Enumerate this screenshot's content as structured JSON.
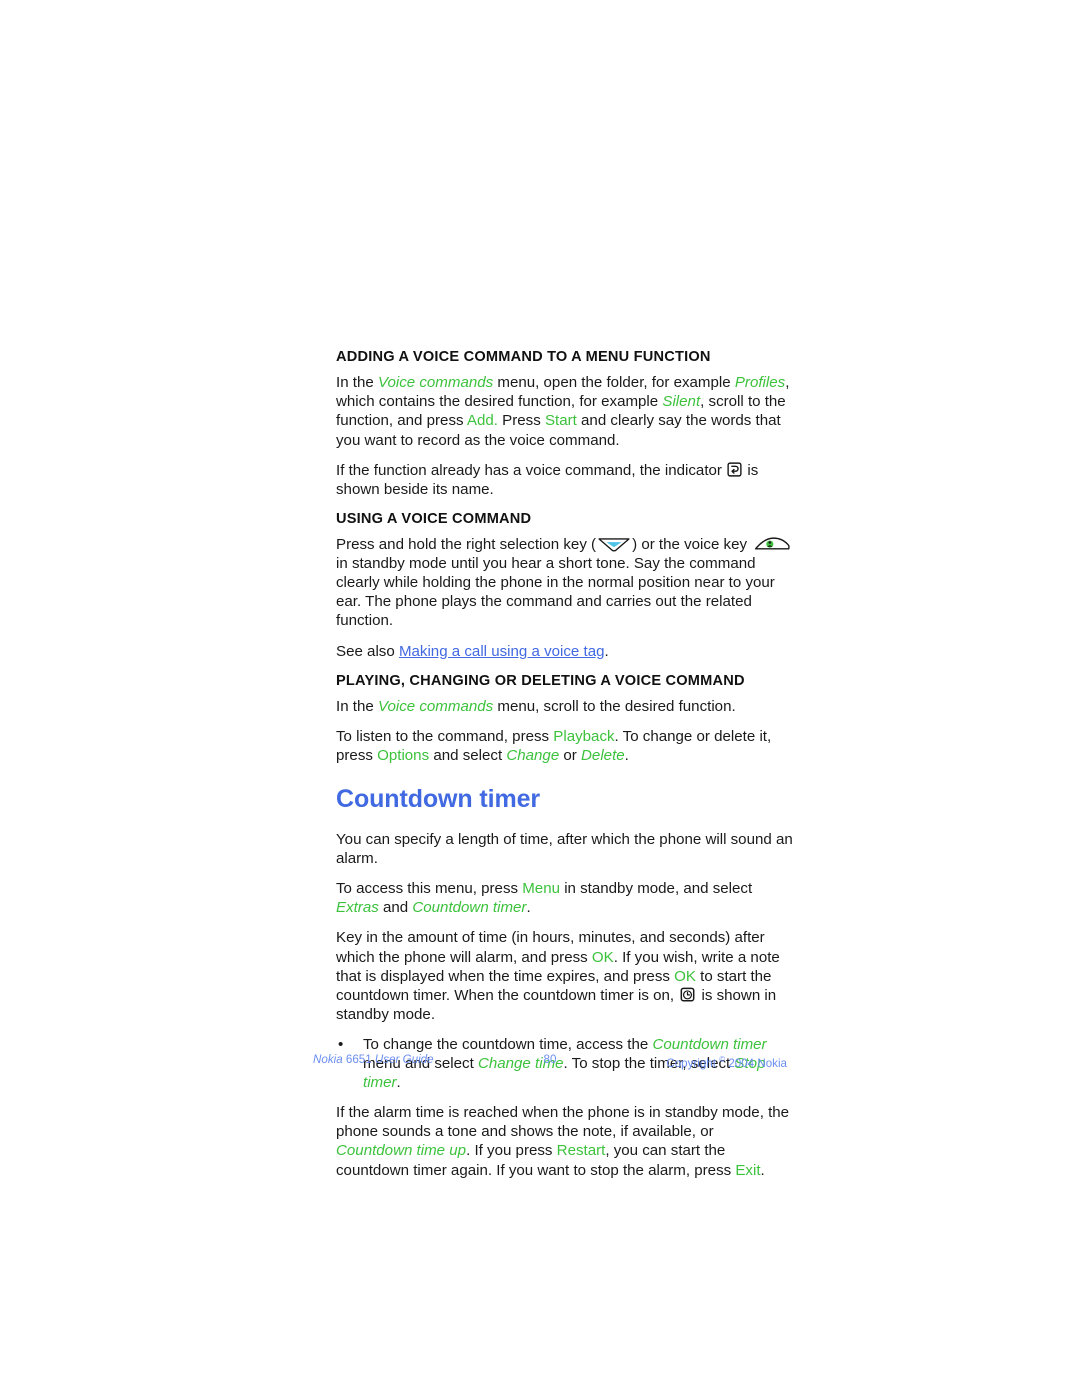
{
  "document": {
    "type": "user-guide-page",
    "page_number": "80",
    "colors": {
      "accent_green": "#3cc23c",
      "heading_blue": "#4169e1",
      "link_blue": "#4169e1",
      "footer_blue": "#6b8ef0",
      "body_black": "#1a1a1a",
      "page_background": "#ffffff"
    }
  },
  "sections": [
    {
      "id": "adding-voice-command",
      "heading": "ADDING A VOICE COMMAND TO A MENU FUNCTION",
      "paragraphs": [
        {
          "id": "adding-p1",
          "runs": [
            {
              "text": "In the ",
              "style": "plain"
            },
            {
              "text": "Voice commands",
              "style": "green-italic"
            },
            {
              "text": " menu, open the folder, for example ",
              "style": "plain"
            },
            {
              "text": "Profiles",
              "style": "green-italic"
            },
            {
              "text": ", which contains the desired function, for example ",
              "style": "plain"
            },
            {
              "text": "Silent",
              "style": "green-italic"
            },
            {
              "text": ", scroll to the function, and press ",
              "style": "plain"
            },
            {
              "text": "Add.",
              "style": "green"
            },
            {
              "text": " Press ",
              "style": "plain"
            },
            {
              "text": "Start",
              "style": "green"
            },
            {
              "text": " and clearly say the words that you want to record as the voice command.",
              "style": "plain"
            }
          ]
        },
        {
          "id": "adding-p2",
          "runs": [
            {
              "text": "If the function already has a voice command, the indicator ",
              "style": "plain"
            },
            {
              "text": "",
              "style": "icon",
              "icon": "voice-tag-indicator-icon"
            },
            {
              "text": " is shown beside its name.",
              "style": "plain"
            }
          ]
        }
      ]
    },
    {
      "id": "using-voice-command",
      "heading": "USING A VOICE COMMAND",
      "paragraphs": [
        {
          "id": "using-p1",
          "runs": [
            {
              "text": "Press and hold the right selection key (",
              "style": "plain"
            },
            {
              "text": "",
              "style": "icon",
              "icon": "right-selection-key-icon"
            },
            {
              "text": ") or the voice key ",
              "style": "plain"
            },
            {
              "text": "",
              "style": "icon",
              "icon": "voice-key-icon"
            },
            {
              "text": " in standby mode until you hear a short tone. Say the command clearly while holding the phone in the normal position near to your ear. The phone plays the command and carries out the related function.",
              "style": "plain"
            }
          ]
        },
        {
          "id": "using-p2",
          "runs": [
            {
              "text": "See also ",
              "style": "plain"
            },
            {
              "text": "Making a call using a voice tag",
              "style": "link"
            },
            {
              "text": ".",
              "style": "plain"
            }
          ]
        }
      ]
    },
    {
      "id": "playing-changing-deleting",
      "heading": "PLAYING, CHANGING OR DELETING A VOICE COMMAND",
      "paragraphs": [
        {
          "id": "playing-p1",
          "runs": [
            {
              "text": "In the ",
              "style": "plain"
            },
            {
              "text": "Voice commands",
              "style": "green-italic"
            },
            {
              "text": " menu, scroll to the desired function.",
              "style": "plain"
            }
          ]
        },
        {
          "id": "playing-p2",
          "runs": [
            {
              "text": "To listen to the command, press ",
              "style": "plain"
            },
            {
              "text": "Playback",
              "style": "green"
            },
            {
              "text": ". To change or delete it, press ",
              "style": "plain"
            },
            {
              "text": "Options",
              "style": "green"
            },
            {
              "text": " and select ",
              "style": "plain"
            },
            {
              "text": "Change",
              "style": "green-italic"
            },
            {
              "text": " or ",
              "style": "plain"
            },
            {
              "text": "Delete",
              "style": "green-italic"
            },
            {
              "text": ".",
              "style": "plain"
            }
          ]
        }
      ]
    }
  ],
  "chapter": {
    "id": "countdown-timer",
    "title": "Countdown timer",
    "paragraphs": [
      {
        "id": "ct-p1",
        "runs": [
          {
            "text": "You can specify a length of time, after which the phone will sound an alarm.",
            "style": "plain"
          }
        ]
      },
      {
        "id": "ct-p2",
        "runs": [
          {
            "text": "To access this menu, press ",
            "style": "plain"
          },
          {
            "text": "Menu",
            "style": "green"
          },
          {
            "text": " in standby mode, and select ",
            "style": "plain"
          },
          {
            "text": "Extras",
            "style": "green-italic"
          },
          {
            "text": " and ",
            "style": "plain"
          },
          {
            "text": "Countdown timer",
            "style": "green-italic"
          },
          {
            "text": ".",
            "style": "plain"
          }
        ]
      },
      {
        "id": "ct-p3",
        "runs": [
          {
            "text": "Key in the amount of time (in hours, minutes, and seconds) after which the phone will alarm, and press ",
            "style": "plain"
          },
          {
            "text": "OK",
            "style": "green"
          },
          {
            "text": ". If you wish, write a note that is displayed when the time expires, and press ",
            "style": "plain"
          },
          {
            "text": "OK",
            "style": "green"
          },
          {
            "text": " to start the countdown timer. When the countdown timer is on, ",
            "style": "plain"
          },
          {
            "text": "",
            "style": "icon",
            "icon": "countdown-timer-indicator-icon"
          },
          {
            "text": " is shown in standby mode.",
            "style": "plain"
          }
        ]
      }
    ],
    "bullets": [
      {
        "id": "ct-bullet-1",
        "marker": "•",
        "runs": [
          {
            "text": "To change the countdown time, access the ",
            "style": "plain"
          },
          {
            "text": "Countdown timer",
            "style": "green-italic"
          },
          {
            "text": " menu and select ",
            "style": "plain"
          },
          {
            "text": "Change time",
            "style": "green-italic"
          },
          {
            "text": ". To stop the timer, select ",
            "style": "plain"
          },
          {
            "text": "Stop timer",
            "style": "green-italic"
          },
          {
            "text": ".",
            "style": "plain"
          }
        ]
      }
    ],
    "trailing_paragraphs": [
      {
        "id": "ct-p4",
        "runs": [
          {
            "text": "If the alarm time is reached when the phone is in standby mode, the phone sounds a tone and shows the note, if available, or ",
            "style": "plain"
          },
          {
            "text": "Countdown time up",
            "style": "green-italic"
          },
          {
            "text": ". If you press ",
            "style": "plain"
          },
          {
            "text": "Restart",
            "style": "green"
          },
          {
            "text": ", you can start the countdown timer again. If you want to stop the alarm, press ",
            "style": "plain"
          },
          {
            "text": "Exit",
            "style": "green"
          },
          {
            "text": ".",
            "style": "plain"
          }
        ]
      }
    ]
  },
  "footer": {
    "brand": "Nokia",
    "model": "6651",
    "guide_label": "User Guide",
    "page_number": "80",
    "copyright_prefix": "Copyright",
    "copyright_symbol": "©",
    "copyright_text": "2004 Nokia"
  }
}
